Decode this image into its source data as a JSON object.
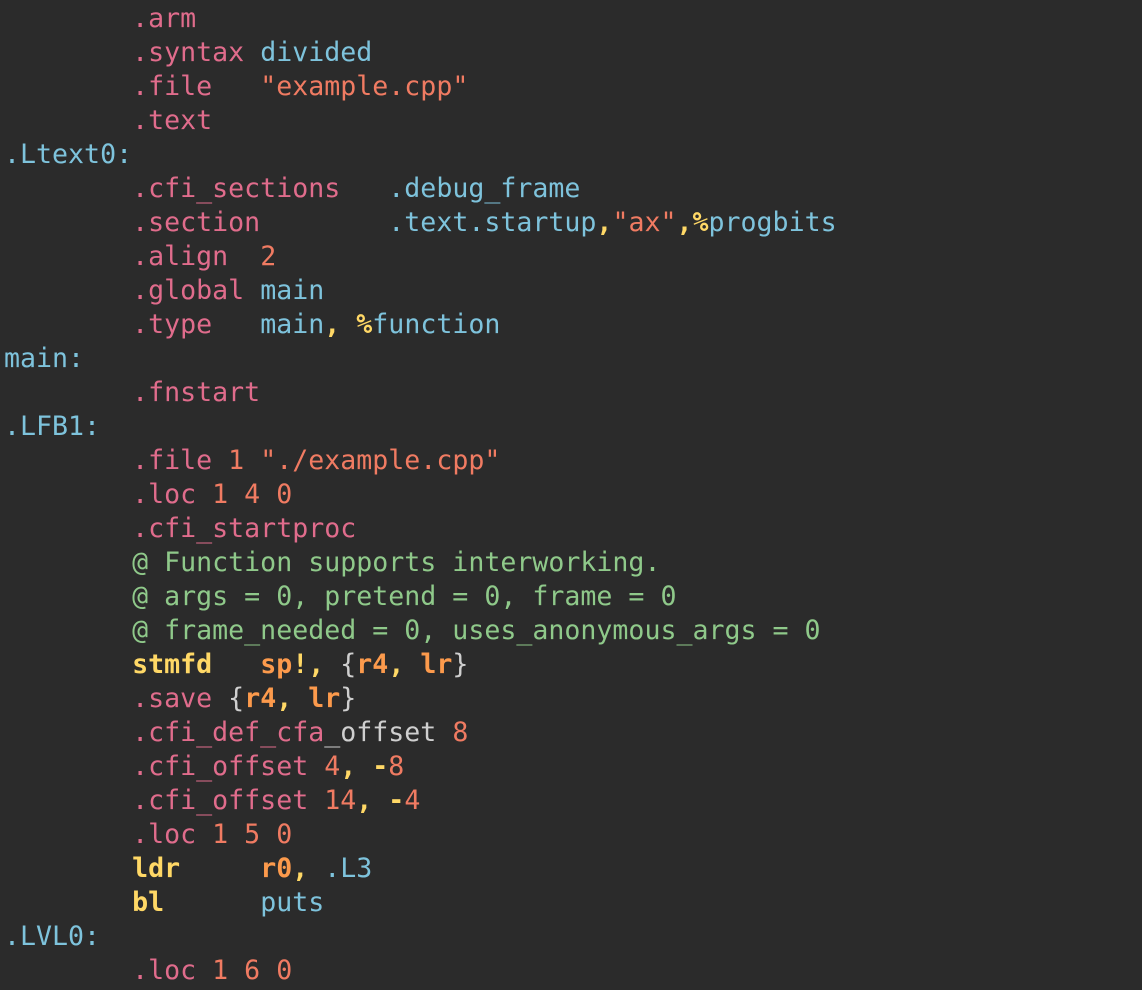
{
  "editor": {
    "background": "#2b2b2b",
    "colors": {
      "directive": "#e06c8c",
      "label": "#7ec3dc",
      "number": "#f07b62",
      "comment": "#8fc98a",
      "instruction": "#ffd866",
      "register": "#fc9a4c",
      "punctuation": "#ffd866"
    },
    "lines": [
      [
        {
          "t": "        "
        },
        {
          "t": ".arm",
          "c": "dir"
        }
      ],
      [
        {
          "t": "        "
        },
        {
          "t": ".syntax",
          "c": "dir"
        },
        {
          "t": " "
        },
        {
          "t": "divided",
          "c": "lbl"
        }
      ],
      [
        {
          "t": "        "
        },
        {
          "t": ".file",
          "c": "dir"
        },
        {
          "t": "   "
        },
        {
          "t": "\"example.cpp\"",
          "c": "str"
        }
      ],
      [
        {
          "t": "        "
        },
        {
          "t": ".text",
          "c": "dir"
        }
      ],
      [
        {
          "t": ".Ltext0:",
          "c": "lbl"
        }
      ],
      [
        {
          "t": "        "
        },
        {
          "t": ".cfi_sections",
          "c": "dir"
        },
        {
          "t": "   "
        },
        {
          "t": ".debug_frame",
          "c": "lbl"
        }
      ],
      [
        {
          "t": "        "
        },
        {
          "t": ".section",
          "c": "dir"
        },
        {
          "t": "        "
        },
        {
          "t": ".text.startup",
          "c": "lbl"
        },
        {
          "t": ",",
          "c": "punct"
        },
        {
          "t": "\"ax\"",
          "c": "str"
        },
        {
          "t": ",",
          "c": "punct"
        },
        {
          "t": "%",
          "c": "pct"
        },
        {
          "t": "progbits",
          "c": "lbl"
        }
      ],
      [
        {
          "t": "        "
        },
        {
          "t": ".align",
          "c": "dir"
        },
        {
          "t": "  "
        },
        {
          "t": "2",
          "c": "num"
        }
      ],
      [
        {
          "t": "        "
        },
        {
          "t": ".global",
          "c": "dir"
        },
        {
          "t": " "
        },
        {
          "t": "main",
          "c": "lbl"
        }
      ],
      [
        {
          "t": "        "
        },
        {
          "t": ".type",
          "c": "dir"
        },
        {
          "t": "   "
        },
        {
          "t": "main",
          "c": "lbl"
        },
        {
          "t": ",",
          "c": "punct"
        },
        {
          "t": " "
        },
        {
          "t": "%",
          "c": "pct"
        },
        {
          "t": "function",
          "c": "lbl"
        }
      ],
      [
        {
          "t": "main:",
          "c": "lbl"
        }
      ],
      [
        {
          "t": "        "
        },
        {
          "t": ".fnstart",
          "c": "dir"
        }
      ],
      [
        {
          "t": ".LFB1:",
          "c": "lbl"
        }
      ],
      [
        {
          "t": "        "
        },
        {
          "t": ".file",
          "c": "dir"
        },
        {
          "t": " "
        },
        {
          "t": "1",
          "c": "num"
        },
        {
          "t": " "
        },
        {
          "t": "\"./example.cpp\"",
          "c": "str"
        }
      ],
      [
        {
          "t": "        "
        },
        {
          "t": ".loc",
          "c": "dir"
        },
        {
          "t": " "
        },
        {
          "t": "1 4 0",
          "c": "num"
        }
      ],
      [
        {
          "t": "        "
        },
        {
          "t": ".cfi_startproc",
          "c": "dir"
        }
      ],
      [
        {
          "t": "        "
        },
        {
          "t": "@ Function supports interworking.",
          "c": "cmt"
        }
      ],
      [
        {
          "t": "        "
        },
        {
          "t": "@ args = 0, pretend = 0, frame = 0",
          "c": "cmt"
        }
      ],
      [
        {
          "t": "        "
        },
        {
          "t": "@ frame_needed = 0, uses_anonymous_args = 0",
          "c": "cmt"
        }
      ],
      [
        {
          "t": "        "
        },
        {
          "t": "stmfd",
          "c": "ins"
        },
        {
          "t": "   "
        },
        {
          "t": "sp",
          "c": "reg"
        },
        {
          "t": "!,",
          "c": "punct"
        },
        {
          "t": " "
        },
        {
          "t": "{",
          "c": "brace"
        },
        {
          "t": "r4",
          "c": "reg"
        },
        {
          "t": ",",
          "c": "punct"
        },
        {
          "t": " "
        },
        {
          "t": "lr",
          "c": "reg"
        },
        {
          "t": "}",
          "c": "brace"
        }
      ],
      [
        {
          "t": "        "
        },
        {
          "t": ".save",
          "c": "dir"
        },
        {
          "t": " "
        },
        {
          "t": "{",
          "c": "brace"
        },
        {
          "t": "r4",
          "c": "reg"
        },
        {
          "t": ",",
          "c": "punct"
        },
        {
          "t": " "
        },
        {
          "t": "lr",
          "c": "reg"
        },
        {
          "t": "}",
          "c": "brace"
        }
      ],
      [
        {
          "t": "        "
        },
        {
          "t": ".cfi_def_cfa",
          "c": "dir"
        },
        {
          "t": "_offset",
          "c": "plain"
        },
        {
          "t": " "
        },
        {
          "t": "8",
          "c": "num"
        }
      ],
      [
        {
          "t": "        "
        },
        {
          "t": ".cfi_offset",
          "c": "dir"
        },
        {
          "t": " "
        },
        {
          "t": "4",
          "c": "num"
        },
        {
          "t": ",",
          "c": "punct"
        },
        {
          "t": " "
        },
        {
          "t": "-",
          "c": "punct"
        },
        {
          "t": "8",
          "c": "num"
        }
      ],
      [
        {
          "t": "        "
        },
        {
          "t": ".cfi_offset",
          "c": "dir"
        },
        {
          "t": " "
        },
        {
          "t": "14",
          "c": "num"
        },
        {
          "t": ",",
          "c": "punct"
        },
        {
          "t": " "
        },
        {
          "t": "-",
          "c": "punct"
        },
        {
          "t": "4",
          "c": "num"
        }
      ],
      [
        {
          "t": "        "
        },
        {
          "t": ".loc",
          "c": "dir"
        },
        {
          "t": " "
        },
        {
          "t": "1 5 0",
          "c": "num"
        }
      ],
      [
        {
          "t": "        "
        },
        {
          "t": "ldr",
          "c": "ins"
        },
        {
          "t": "     "
        },
        {
          "t": "r0",
          "c": "reg"
        },
        {
          "t": ",",
          "c": "punct"
        },
        {
          "t": " "
        },
        {
          "t": ".L3",
          "c": "lbl"
        }
      ],
      [
        {
          "t": "        "
        },
        {
          "t": "bl",
          "c": "ins"
        },
        {
          "t": "      "
        },
        {
          "t": "puts",
          "c": "lbl"
        }
      ],
      [
        {
          "t": ".LVL0:",
          "c": "lbl"
        }
      ],
      [
        {
          "t": "        "
        },
        {
          "t": ".loc",
          "c": "dir"
        },
        {
          "t": " "
        },
        {
          "t": "1 6 0",
          "c": "num"
        }
      ]
    ]
  }
}
